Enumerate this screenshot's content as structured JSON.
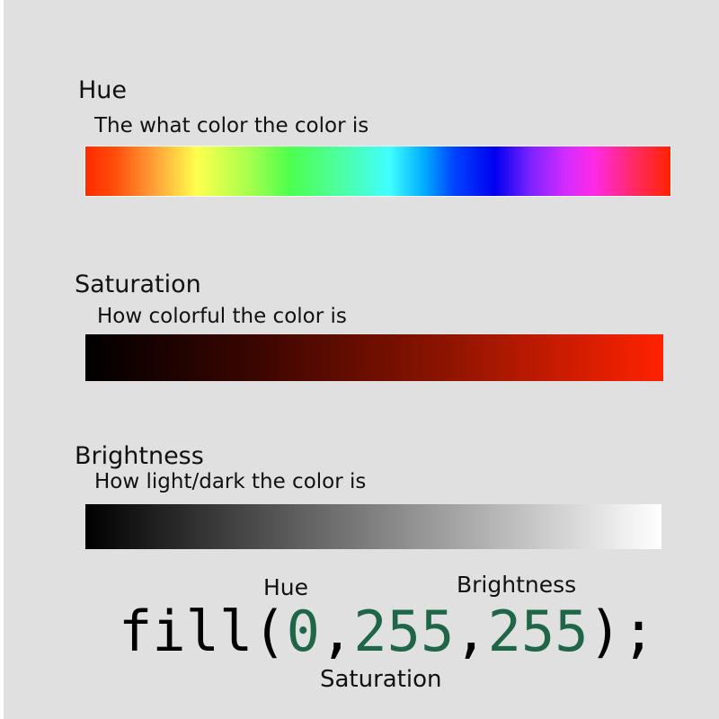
{
  "sections": {
    "hue": {
      "title": "Hue",
      "description": "The what color the color is"
    },
    "saturation": {
      "title": "Saturation",
      "description": "How colorful the color is"
    },
    "brightness": {
      "title": "Brightness",
      "description": "How light/dark the color is"
    }
  },
  "gradients": {
    "hue": [
      "#ff2a00",
      "#ffff4d",
      "#4dff4d",
      "#40ffff",
      "#0000f0",
      "#ff2ae6",
      "#ff2200"
    ],
    "saturation": [
      "#000000",
      "#ff2200"
    ],
    "brightness": [
      "#000000",
      "#ffffff"
    ]
  },
  "code": {
    "func": "fill(",
    "arg1": "0",
    "sep1": ",",
    "arg2": "255",
    "sep2": ",",
    "arg3": "255",
    "close": ");"
  },
  "annotations": {
    "hue": "Hue",
    "saturation": "Saturation",
    "brightness": "Brightness"
  },
  "colors": {
    "background": "#e0e0e0",
    "argument": "#1e6647",
    "text": "#111111"
  }
}
